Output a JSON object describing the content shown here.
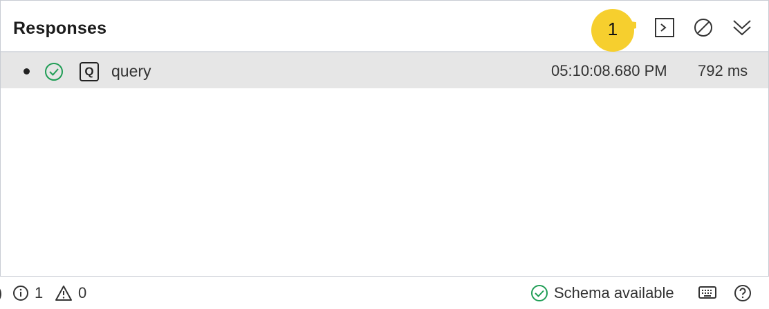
{
  "panel": {
    "title": "Responses",
    "callout_number": "1",
    "toolbar": {
      "console_icon": "terminal-icon",
      "clear_icon": "clear-icon",
      "collapse_icon": "chevron-double-down-icon"
    }
  },
  "responses": [
    {
      "status": "success",
      "type_badge": "Q",
      "name": "query",
      "time": "05:10:08.680 PM",
      "duration": "792 ms"
    }
  ],
  "statusbar": {
    "left_partial": ")",
    "info_count": "1",
    "warning_count": "0",
    "schema_status": "Schema available"
  },
  "colors": {
    "callout": "#f6cf2e",
    "success": "#1f9d55",
    "row_bg": "#e6e6e6",
    "border": "#c8ccd3"
  }
}
